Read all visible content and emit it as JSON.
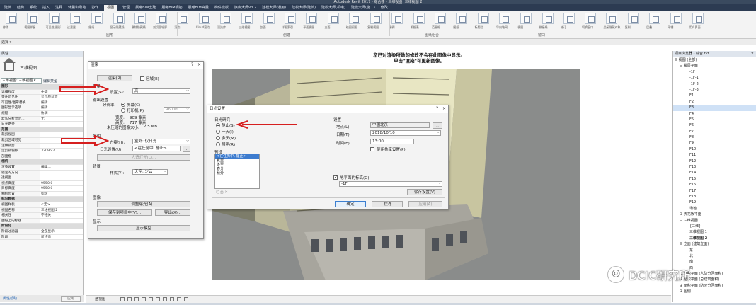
{
  "window": {
    "title": "Autodesk Revit 2017 -   综合楼 - 三维视图: 三维视图 2"
  },
  "ribbon": {
    "tabs": [
      "建筑",
      "结构",
      "系统",
      "插入",
      "注释",
      "体量和场地",
      "协作",
      "视图",
      "管理",
      "晨曦BIM土建",
      "晨曦BIM钢筋",
      "晨曦BIM算量",
      "构件模板",
      "族库大师V3.2",
      "建模大师(通用)",
      "建模大师(建筑)",
      "建模大师(机电)",
      "建模大师(施工)",
      "修改"
    ],
    "active_tab": "视图",
    "groups": [
      "图形",
      "创建",
      "图纸组合",
      "窗口"
    ],
    "buttons": [
      "修改",
      "视图样板",
      "可见性/图形",
      "过滤器",
      "细线",
      "显示隐藏线",
      "删除隐藏线",
      "剖切面轮廓",
      "渲染",
      "Cloud渲染",
      "渲染库",
      "三维视图",
      "剖面",
      "详图索引",
      "平面视图",
      "立面",
      "绘图视图",
      "复制视图",
      "图例",
      "明细表",
      "范围框",
      "图纸",
      "标题栏",
      "导向轴网",
      "视图",
      "拼接线",
      "修订",
      "切换窗口",
      "关闭隐藏对象",
      "复制",
      "层叠",
      "平铺",
      "用户界面"
    ]
  },
  "quickbar": {
    "label": "选择 ▾"
  },
  "properties": {
    "header": "属性",
    "type_name": "三维视图",
    "selector": "三维视图: 三维视图 ▾",
    "edit_type": "编辑类型",
    "rows": [
      {
        "k": "图形",
        "v": "",
        "group": true
      },
      {
        "k": "详细程度",
        "v": "中等"
      },
      {
        "k": "零件可见性",
        "v": "显示原状态"
      },
      {
        "k": "可见性/图形替换",
        "v": "编辑..."
      },
      {
        "k": "图形显示选项",
        "v": "编辑..."
      },
      {
        "k": "规程",
        "v": "协调"
      },
      {
        "k": "默认分析显示...",
        "v": "无"
      },
      {
        "k": "日光路径",
        "v": ""
      },
      {
        "k": "范围",
        "v": "",
        "group": true
      },
      {
        "k": "裁剪视图",
        "v": ""
      },
      {
        "k": "裁剪区域可见",
        "v": ""
      },
      {
        "k": "注释裁剪",
        "v": ""
      },
      {
        "k": "远剪裁偏移",
        "v": "32096.2"
      },
      {
        "k": "剖面框",
        "v": ""
      },
      {
        "k": "相机",
        "v": "",
        "group": true
      },
      {
        "k": "渲染设置",
        "v": "编辑..."
      },
      {
        "k": "锁定的方向",
        "v": ""
      },
      {
        "k": "透视图",
        "v": ""
      },
      {
        "k": "视点高度",
        "v": "9550.0"
      },
      {
        "k": "目标高度",
        "v": "9550.0"
      },
      {
        "k": "相机位置",
        "v": "指定"
      },
      {
        "k": "标识数据",
        "v": "",
        "group": true
      },
      {
        "k": "视图样板",
        "v": "<无>"
      },
      {
        "k": "视图名称",
        "v": "三维视图 2"
      },
      {
        "k": "相关性",
        "v": "不相关"
      },
      {
        "k": "图纸上的标题",
        "v": ""
      },
      {
        "k": "阶段化",
        "v": "",
        "group": true
      },
      {
        "k": "阶段过滤器",
        "v": "全部显示"
      },
      {
        "k": "阶段",
        "v": "新构造"
      }
    ],
    "help_link": "属性帮助",
    "apply": "应用"
  },
  "canvas": {
    "banner_line1": "您已对渲染所做的修改不会在此图像中显示。",
    "banner_line2": "单击\"渲染\"可更新图像。"
  },
  "render_dialog": {
    "title": "渲染",
    "help": "?",
    "close": "×",
    "render_btn": "渲染(R)",
    "region_label": "区域(E)",
    "quality_heading": "质量",
    "quality_label": "设置(S):",
    "quality_value": "高",
    "output_heading": "输出设置",
    "resolution_label": "分辨率:",
    "screen_label": "屏幕(C)",
    "printer_label": "打印机(P)",
    "dpi_value": "96 DPI",
    "width_label": "宽度:",
    "width_value": "909 像素",
    "height_label": "高度:",
    "height_value": "717 像素",
    "size_label": "未压缩的图像大小:",
    "size_value": "2.5 MB",
    "lighting_heading": "照明",
    "scheme_label": "方案(H):",
    "scheme_value": "室外: 仅日光",
    "sun_label": "日光设置(U):",
    "sun_value": "<在任务中, 静止>",
    "artificial_btn": "人造灯光(L)...",
    "background_heading": "背景",
    "style_label": "样式(Y):",
    "style_value": "天空: 少云",
    "image_heading": "图像",
    "exposure_btn": "调整曝光(A)...",
    "save_btn": "保存到项目中(V)...",
    "export_btn": "导出(X)...",
    "display_heading": "显示",
    "display_btn": "显示模型"
  },
  "sun_dialog": {
    "title": "日光设置",
    "help": "?",
    "close": "×",
    "study_heading": "日光研究",
    "study_options": [
      "静止(S)",
      "一天(I)",
      "多天(M)",
      "照明(R)"
    ],
    "study_selected": 0,
    "preset_heading": "预设",
    "presets": [
      "<在任务中, 静止>",
      "夏至",
      "冬至",
      "春分",
      "秋分"
    ],
    "preset_selected": 0,
    "settings_heading": "设置",
    "location_label": "地点(L):",
    "location_value": "中国北京",
    "location_btn": "...",
    "date_label": "日期(T):",
    "date_value": "2018/10/10",
    "time_label": "时间(E):",
    "time_value": "13:00",
    "shared_label": "使用共享设置(P)",
    "ground_label": "地平面的标高(G):",
    "ground_value": "-1F",
    "save_settings": "保存设置(V)",
    "ok": "确定",
    "cancel": "取消",
    "apply": "应用(A)"
  },
  "statusbar": {
    "view_label": "透视图"
  },
  "browser": {
    "header": "项目浏览器 - 综合.rvt",
    "close": "×",
    "tree": [
      {
        "t": "⊟ 视图 (全部)",
        "d": 0
      },
      {
        "t": "⊟ 楼层平面",
        "d": 1
      },
      {
        "t": "-1F",
        "d": 3
      },
      {
        "t": "-1F-1",
        "d": 3
      },
      {
        "t": "-1F-2",
        "d": 3
      },
      {
        "t": "-1F-3",
        "d": 3
      },
      {
        "t": "F1",
        "d": 3
      },
      {
        "t": "F2",
        "d": 3
      },
      {
        "t": "F3",
        "d": 3,
        "sel": true
      },
      {
        "t": "F4",
        "d": 3
      },
      {
        "t": "F5",
        "d": 3
      },
      {
        "t": "F6",
        "d": 3
      },
      {
        "t": "F7",
        "d": 3
      },
      {
        "t": "F8",
        "d": 3
      },
      {
        "t": "F9",
        "d": 3
      },
      {
        "t": "F10",
        "d": 3
      },
      {
        "t": "F11",
        "d": 3
      },
      {
        "t": "F12",
        "d": 3
      },
      {
        "t": "F13",
        "d": 3
      },
      {
        "t": "F14",
        "d": 3
      },
      {
        "t": "F15",
        "d": 3
      },
      {
        "t": "F16",
        "d": 3
      },
      {
        "t": "F17",
        "d": 3
      },
      {
        "t": "F18",
        "d": 3
      },
      {
        "t": "F19",
        "d": 3
      },
      {
        "t": "场地",
        "d": 3
      },
      {
        "t": "⊞ 天花板平面",
        "d": 1
      },
      {
        "t": "⊟ 三维视图",
        "d": 1
      },
      {
        "t": "{三维}",
        "d": 3
      },
      {
        "t": "三维视图 1",
        "d": 3
      },
      {
        "t": "三维视图 2",
        "d": 3,
        "bold": true
      },
      {
        "t": "⊟ 立面 (建筑立面)",
        "d": 1
      },
      {
        "t": "东",
        "d": 3
      },
      {
        "t": "北",
        "d": 3
      },
      {
        "t": "南",
        "d": 3
      },
      {
        "t": "西",
        "d": 3
      },
      {
        "t": "⊞ 面积平面 (人防分区面积)",
        "d": 1
      },
      {
        "t": "⊞ 面积平面 (总建筑面积)",
        "d": 1
      },
      {
        "t": "⊞ 面积平面 (防火分区面积)",
        "d": 1
      },
      {
        "t": "⊞ 图例",
        "d": 1
      }
    ]
  },
  "watermark": {
    "text": "DCIC研究所"
  }
}
